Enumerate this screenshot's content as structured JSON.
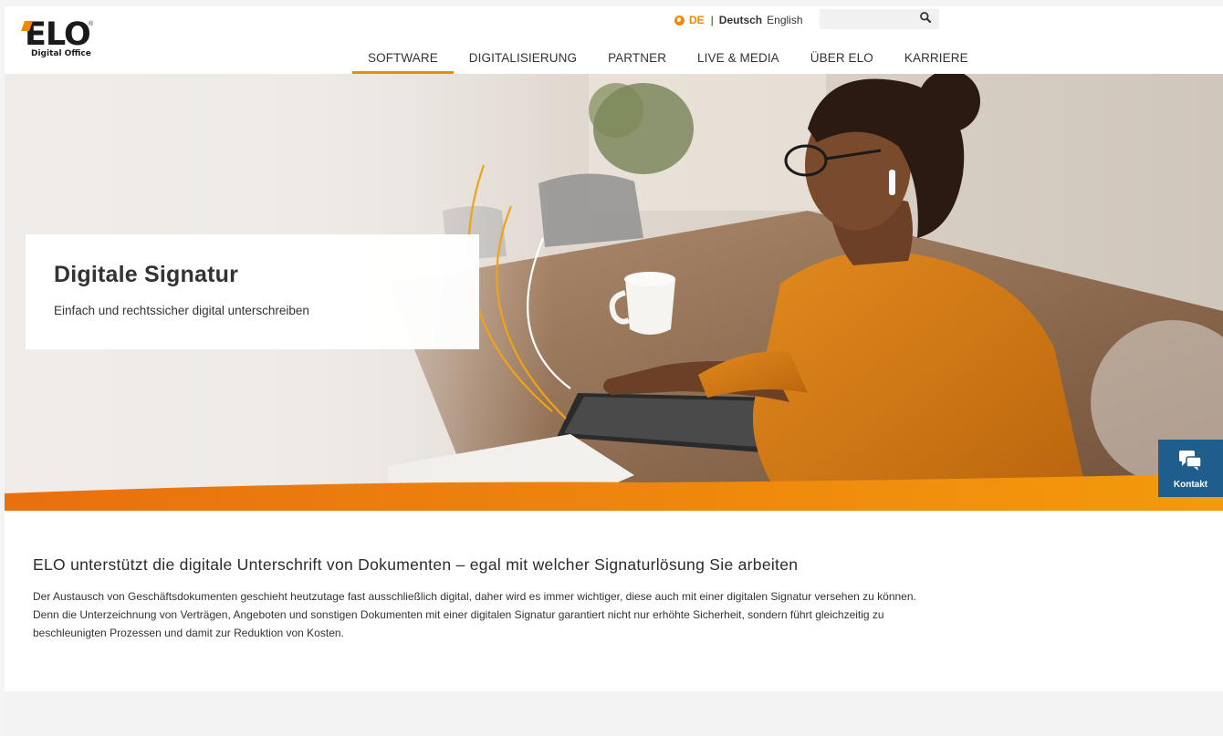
{
  "logo": {
    "mark": "ELO",
    "registered": "®",
    "subtitle": "Digital Office"
  },
  "language": {
    "current": "DE",
    "separator": "|",
    "options": [
      "Deutsch",
      "English"
    ]
  },
  "search": {
    "placeholder": ""
  },
  "nav": {
    "items": [
      "SOFTWARE",
      "DIGITALISIERUNG",
      "PARTNER",
      "LIVE & MEDIA",
      "ÜBER ELO",
      "KARRIERE"
    ],
    "active": "SOFTWARE"
  },
  "hero": {
    "title": "Digitale Signatur",
    "subtitle": "Einfach und rechtssicher digital unterschreiben"
  },
  "kontakt": {
    "label": "Kontakt",
    "icon": "chat-bubbles-icon"
  },
  "section": {
    "heading": "ELO unterstützt die digitale Unterschrift von Dokumenten – egal mit welcher Signaturlösung Sie arbeiten",
    "body": "Der Austausch von Geschäftsdokumenten geschieht heutzutage fast ausschließlich digital, daher wird es immer wichtiger, diese auch mit einer digitalen Signatur versehen zu können. Denn die Unterzeichnung von Verträgen, Angeboten und sonstigen Dokumenten mit einer digitalen Signatur garantiert nicht nur erhöhte Sicherheit, sondern führt gleichzeitig zu beschleunigten Prozessen und damit zur Reduktion von Kosten."
  },
  "colors": {
    "accent": "#f08a00",
    "kontakt_bg": "#1f5d8c",
    "text": "#333333"
  }
}
